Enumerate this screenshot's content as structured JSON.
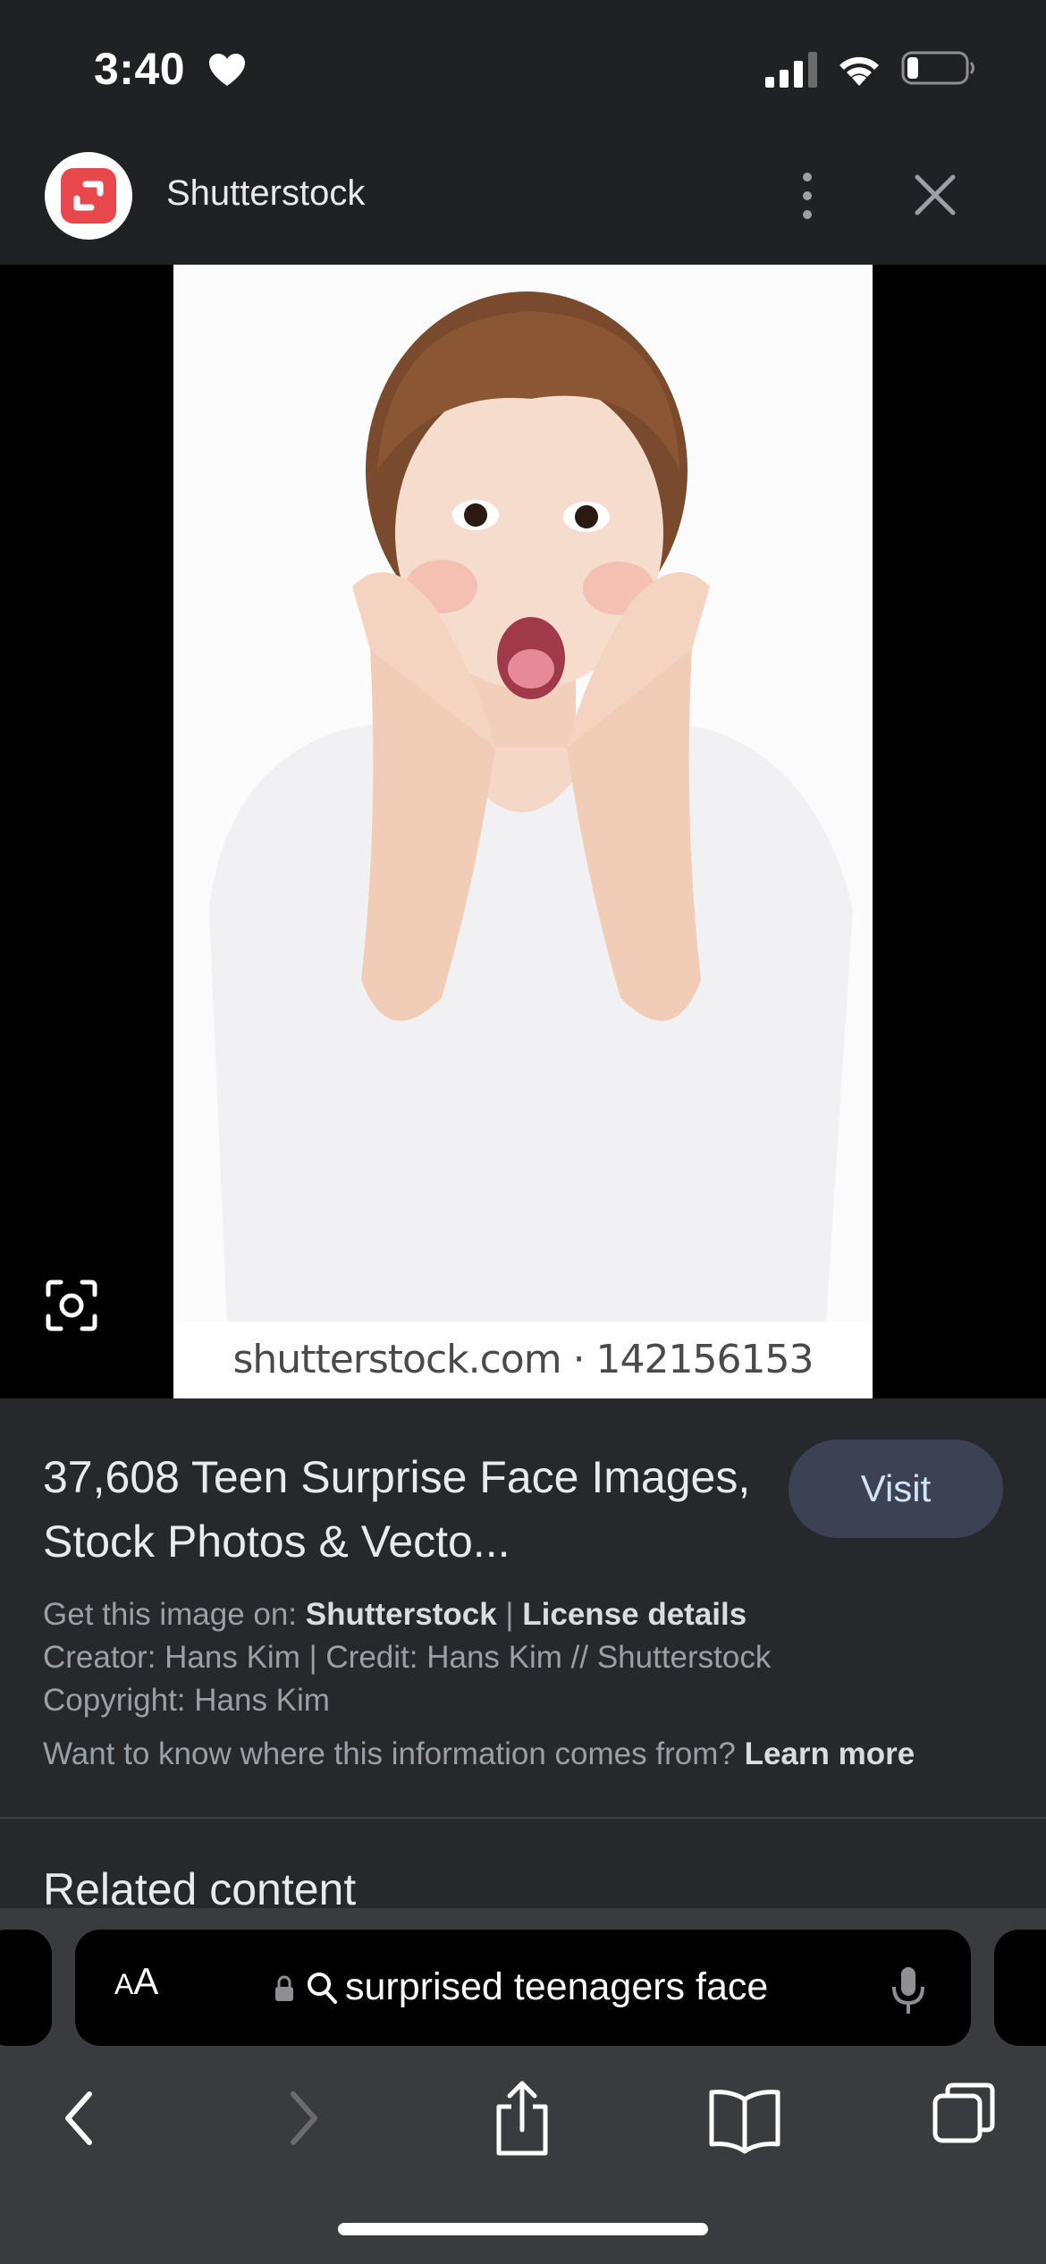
{
  "status_bar": {
    "time": "3:40",
    "icons": [
      "heart-icon",
      "signal-icon",
      "wifi-icon",
      "battery-icon"
    ],
    "battery_level": 0.2
  },
  "header": {
    "site_name": "Shutterstock",
    "logo_color": "#e8484b",
    "icons": [
      "more-icon",
      "close-icon"
    ]
  },
  "viewer": {
    "watermark": "shutterstock.com · 142156153",
    "icons": [
      "lens-icon"
    ]
  },
  "result": {
    "title": "37,608 Teen Surprise Face Images, Stock Photos & Vecto...",
    "visit_label": "Visit",
    "get_image_prefix": "Get this image on: ",
    "get_image_source": "Shutterstock",
    "separator": " | ",
    "license_details": "License details",
    "creator_line": "Creator: Hans Kim | Credit: Hans Kim // Shutterstock",
    "copyright_line": "Copyright: Hans Kim",
    "info_question": "Want to know where this information comes from? ",
    "learn_more": "Learn more"
  },
  "related": {
    "heading": "Related content"
  },
  "browser": {
    "aa_small": "A",
    "aa_large": "A",
    "address": "surprised teenagers face",
    "icons": [
      "lock-icon",
      "search-icon",
      "mic-icon",
      "back-icon",
      "forward-icon",
      "share-icon",
      "bookmarks-icon",
      "tabs-icon"
    ]
  },
  "colors": {
    "background": "#202124",
    "panel": "#27282c",
    "visit_button": "#3c4254",
    "toolbar": "#3a3b3f"
  }
}
